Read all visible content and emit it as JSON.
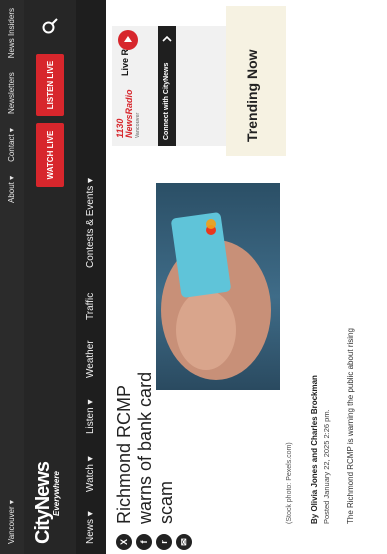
{
  "topbar": {
    "region": "Vancouver ▾",
    "links": [
      "About ▾",
      "Contact ▾",
      "Newsletters",
      "News Insiders"
    ]
  },
  "header": {
    "logo_main": "CityNews",
    "logo_sub": "Everywhere",
    "watch_label": "WATCH LIVE",
    "listen_label": "LISTEN LIVE"
  },
  "nav": {
    "items": [
      "News ▾",
      "Watch ▾",
      "Listen ▾",
      "Weather",
      "Traffic",
      "Contests & Events ▾"
    ]
  },
  "share": {
    "icons": [
      "x-icon",
      "facebook-icon",
      "reddit-icon",
      "email-icon"
    ]
  },
  "article": {
    "headline": "Richmond RCMP warns of bank card scam",
    "caption": "(Stock photo: Pexels.com)",
    "byline": "By Olivia Jones and Charles Brockman",
    "posted": "Posted January 22, 2025 2:26 pm.",
    "body_start": "The Richmond RCMP is warning the public about rising"
  },
  "radio": {
    "logo_text": "1130 NewsRadio",
    "logo_sub": "Vancouver",
    "title": "Live Radio",
    "connect": "Connect with CityNews"
  },
  "trending": {
    "title": "Trending Now"
  },
  "colors": {
    "accent": "#d7262c",
    "header_bg": "#262626",
    "nav_bg": "#1e1e1e"
  }
}
